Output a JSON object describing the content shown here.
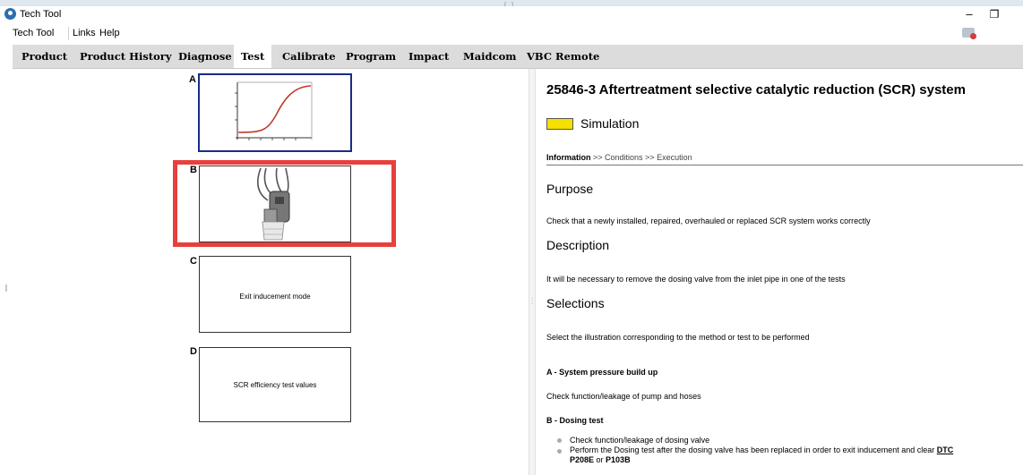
{
  "window": {
    "title": "Tech Tool"
  },
  "menu": [
    "Tech Tool",
    "Links",
    "Help"
  ],
  "tabs": [
    {
      "label": "Product",
      "active": false
    },
    {
      "label": "Product History",
      "active": false
    },
    {
      "label": "Diagnose",
      "active": false
    },
    {
      "label": "Test",
      "active": true
    },
    {
      "label": "Calibrate",
      "active": false
    },
    {
      "label": "Program",
      "active": false
    },
    {
      "label": "Impact",
      "active": false
    },
    {
      "label": "Maidcom",
      "active": false
    },
    {
      "label": "VBC Remote",
      "active": false
    }
  ],
  "cards": [
    {
      "letter": "A",
      "text": ""
    },
    {
      "letter": "B",
      "text": ""
    },
    {
      "letter": "C",
      "text": "Exit inducement mode"
    },
    {
      "letter": "D",
      "text": "SCR efficiency test values"
    }
  ],
  "detail": {
    "title": "25846-3 Aftertreatment selective catalytic reduction (SCR) system",
    "simulation": "Simulation",
    "breadcrumb": {
      "current": "Information",
      "sep1": " >> ",
      "step2": "Conditions",
      "sep2": " >> ",
      "step3": "Execution"
    },
    "purpose_heading": "Purpose",
    "purpose_text": "Check that a newly installed, repaired, overhauled or replaced SCR system works correctly",
    "description_heading": "Description",
    "description_text": "It will be necessary to remove the dosing valve from the inlet pipe in one of the tests",
    "selections_heading": "Selections",
    "selections_text": "Select the illustration corresponding to the method or test to be performed",
    "option_a_title": "A - System pressure build up",
    "option_a_text": "Check function/leakage of pump and hoses",
    "option_b_title": "B - Dosing test",
    "option_b_bullet1": "Check function/leakage of dosing valve",
    "option_b_bullet2_pre": "Perform the Dosing test after the dosing valve has been replaced in order to exit inducement and clear ",
    "option_b_bullet2_link": "DTC",
    "option_b_bullet2_line2_a": "P208E",
    "option_b_bullet2_line2_or": " or ",
    "option_b_bullet2_line2_b": "P103B"
  },
  "colors": {
    "simulation": "#f5e000",
    "highlight": "#e8403c",
    "selected_border": "#1a2a8a",
    "curve": "#c0392b"
  }
}
